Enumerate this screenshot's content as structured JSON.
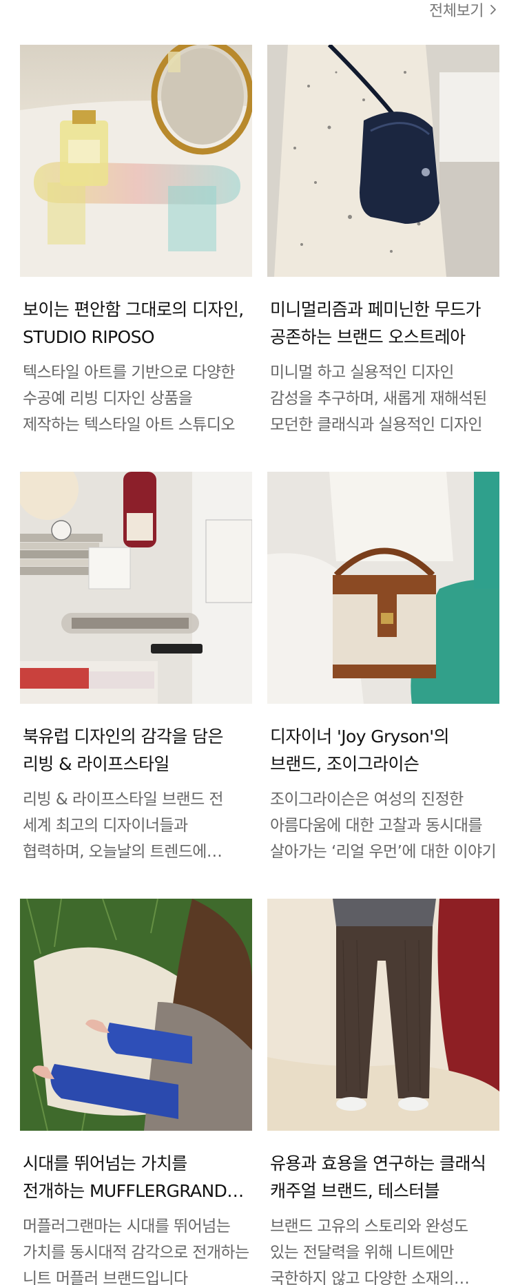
{
  "header": {
    "view_all_label": "전체보기"
  },
  "cards": [
    {
      "title": "보이는 편안함 그대로의 디자인, STUDIO RIPOSO",
      "description": "텍스타일 아트를 기반으로 다양한 수공예 리빙 디자인 상품을 제작하는 텍스타일 아트 스튜디오",
      "image": "perfume-on-acrylic-stand-photo"
    },
    {
      "title": "미니멀리즘과 페미닌한 무드가 공존하는 브랜드 오스트레아",
      "description": "미니멀 하고 실용적인 디자인 감성을 추구하며, 새롭게 재해석된 모던한 클래식과 실용적인 디자인",
      "image": "navy-shoulder-bag-photo"
    },
    {
      "title": "북유럽 디자인의 감각을 담은 리빙 & 라이프스타일",
      "description": "리빙 & 라이프스타일 브랜드 전 세계 최고의 디자이너들과 협력하며, 오늘날의 트렌드에 동시대적 감각을",
      "image": "desk-still-life-photo"
    },
    {
      "title": "디자이너 'Joy Gryson'의 브랜드, 조이그라이슨",
      "description": "조이그라이슨은 여성의 진정한 아름다움에 대한 고찰과 동시대를 살아가는 ‘리얼 우먼’에 대한 이야기",
      "image": "canvas-bucket-bag-photo"
    },
    {
      "title": "시대를 뛰어넘는 가치를 전개하는 MUFFLERGRAND 머플러그랜마",
      "description": "머플러그랜마는 시대를 뛰어넘는 가치를 동시대적 감각으로 전개하는 니트 머플러 브랜드입니다",
      "image": "blue-knit-gloves-photo"
    },
    {
      "title": "유용과 효용을 연구하는 클래식 캐주얼 브랜드, 테스터블",
      "description": "브랜드 고유의 스토리와 완성도 있는 전달력을 위해 니트에만 국한하지 않고 다양한 소재의 아이템",
      "image": "brown-wool-trousers-photo"
    }
  ]
}
